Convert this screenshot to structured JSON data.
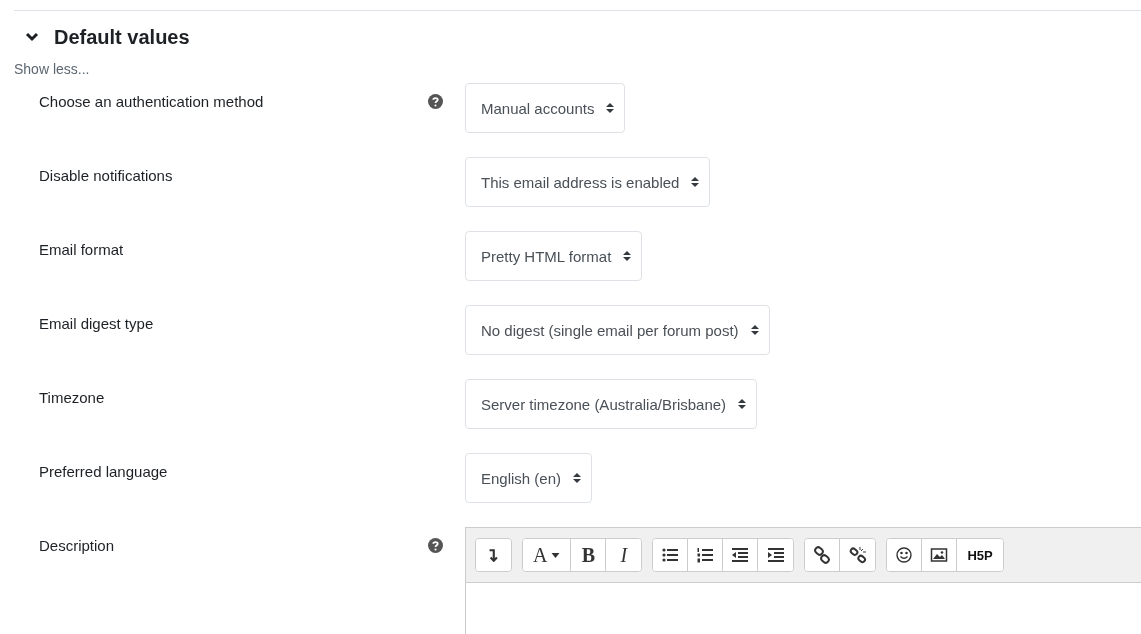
{
  "section": {
    "title": "Default values",
    "expanded": true,
    "toggle_link": "Show less..."
  },
  "fields": [
    {
      "label": "Choose an authentication method",
      "help": true,
      "value": "Manual accounts"
    },
    {
      "label": "Disable notifications",
      "help": false,
      "value": "This email address is enabled"
    },
    {
      "label": "Email format",
      "help": false,
      "value": "Pretty HTML format"
    },
    {
      "label": "Email digest type",
      "help": false,
      "value": "No digest (single email per forum post)"
    },
    {
      "label": "Timezone",
      "help": false,
      "value": "Server timezone (Australia/Brisbane)"
    },
    {
      "label": "Preferred language",
      "help": false,
      "value": "English (en)"
    }
  ],
  "description": {
    "label": "Description",
    "help": true,
    "toolbar": [
      [
        {
          "kind": "toggle"
        }
      ],
      [
        {
          "kind": "menu",
          "text": "A"
        },
        {
          "kind": "bold",
          "text": "B"
        },
        {
          "kind": "italic",
          "text": "I"
        }
      ],
      [
        {
          "kind": "bullets"
        },
        {
          "kind": "numbers"
        },
        {
          "kind": "outdent"
        },
        {
          "kind": "indent"
        }
      ],
      [
        {
          "kind": "link"
        },
        {
          "kind": "unlink"
        }
      ],
      [
        {
          "kind": "emoji"
        },
        {
          "kind": "image"
        },
        {
          "kind": "logo",
          "text": "H5P"
        }
      ]
    ]
  }
}
